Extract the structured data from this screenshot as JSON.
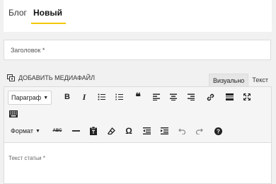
{
  "tabs": {
    "blog": "Блог",
    "new": "Новый"
  },
  "title_field": {
    "placeholder": "Заголовок *"
  },
  "media": {
    "label": "ДОБАВИТЬ МЕДИАФАЙЛ"
  },
  "modes": {
    "visual": "Визуально",
    "text": "Текст"
  },
  "toolbar": {
    "paragraph": "Параграф",
    "format": "Формат",
    "strikethrough": "ABC",
    "omega": "Ω"
  },
  "body": {
    "placeholder": "Текст статьи *"
  },
  "colors": {
    "accent": "#f0c800",
    "page_bg": "#f1f1f1"
  }
}
